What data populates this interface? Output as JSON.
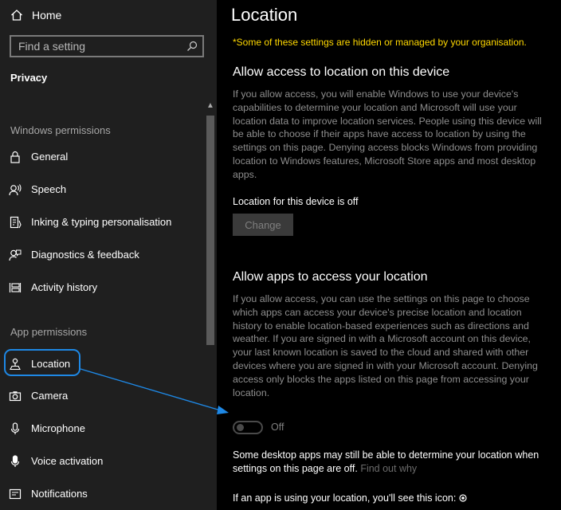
{
  "sidebar": {
    "home_label": "Home",
    "search_placeholder": "Find a setting",
    "breadcrumb": "Privacy",
    "windows_permissions_heading": "Windows permissions",
    "windows_items": [
      {
        "label": "General",
        "icon": "lock-icon"
      },
      {
        "label": "Speech",
        "icon": "speech-icon"
      },
      {
        "label": "Inking & typing personalisation",
        "icon": "inking-icon"
      },
      {
        "label": "Diagnostics & feedback",
        "icon": "feedback-icon"
      },
      {
        "label": "Activity history",
        "icon": "activity-icon"
      }
    ],
    "app_permissions_heading": "App permissions",
    "app_items": [
      {
        "label": "Location",
        "icon": "location-icon",
        "selected": true
      },
      {
        "label": "Camera",
        "icon": "camera-icon"
      },
      {
        "label": "Microphone",
        "icon": "microphone-icon"
      },
      {
        "label": "Voice activation",
        "icon": "voice-icon"
      },
      {
        "label": "Notifications",
        "icon": "notifications-icon"
      }
    ]
  },
  "main": {
    "title": "Location",
    "managed_notice": "*Some of these settings are hidden or managed by your organisation.",
    "device_section": {
      "heading": "Allow access to location on this device",
      "description": "If you allow access, you will enable Windows to use your device's capabilities to determine your location and Microsoft will use your location data to improve location services. People using this device will be able to choose if their apps have access to location by using the settings on this page. Denying access blocks Windows from providing location to Windows features, Microsoft Store apps and most desktop apps.",
      "status": "Location for this device is off",
      "change_button": "Change"
    },
    "apps_section": {
      "heading": "Allow apps to access your location",
      "description": "If you allow access, you can use the settings on this page to choose which apps can access your device's precise location and location history to enable location-based experiences such as directions and weather. If you are signed in with a Microsoft account on this device, your last known location is saved to the cloud and shared with other devices where you are signed in with your Microsoft account. Denying access only blocks the apps listed on this page from accessing your location.",
      "toggle_state": "Off",
      "desktop_note": "Some desktop apps may still be able to determine your location when settings on this page are off.",
      "find_out_why": "Find out why",
      "icon_note": "If an app is using your location, you'll see this icon:"
    }
  },
  "colors": {
    "accent_annotation": "#1e88e5",
    "managed_notice": "#ffd800",
    "sidebar_bg": "#1f1f1f",
    "main_bg": "#000000"
  }
}
